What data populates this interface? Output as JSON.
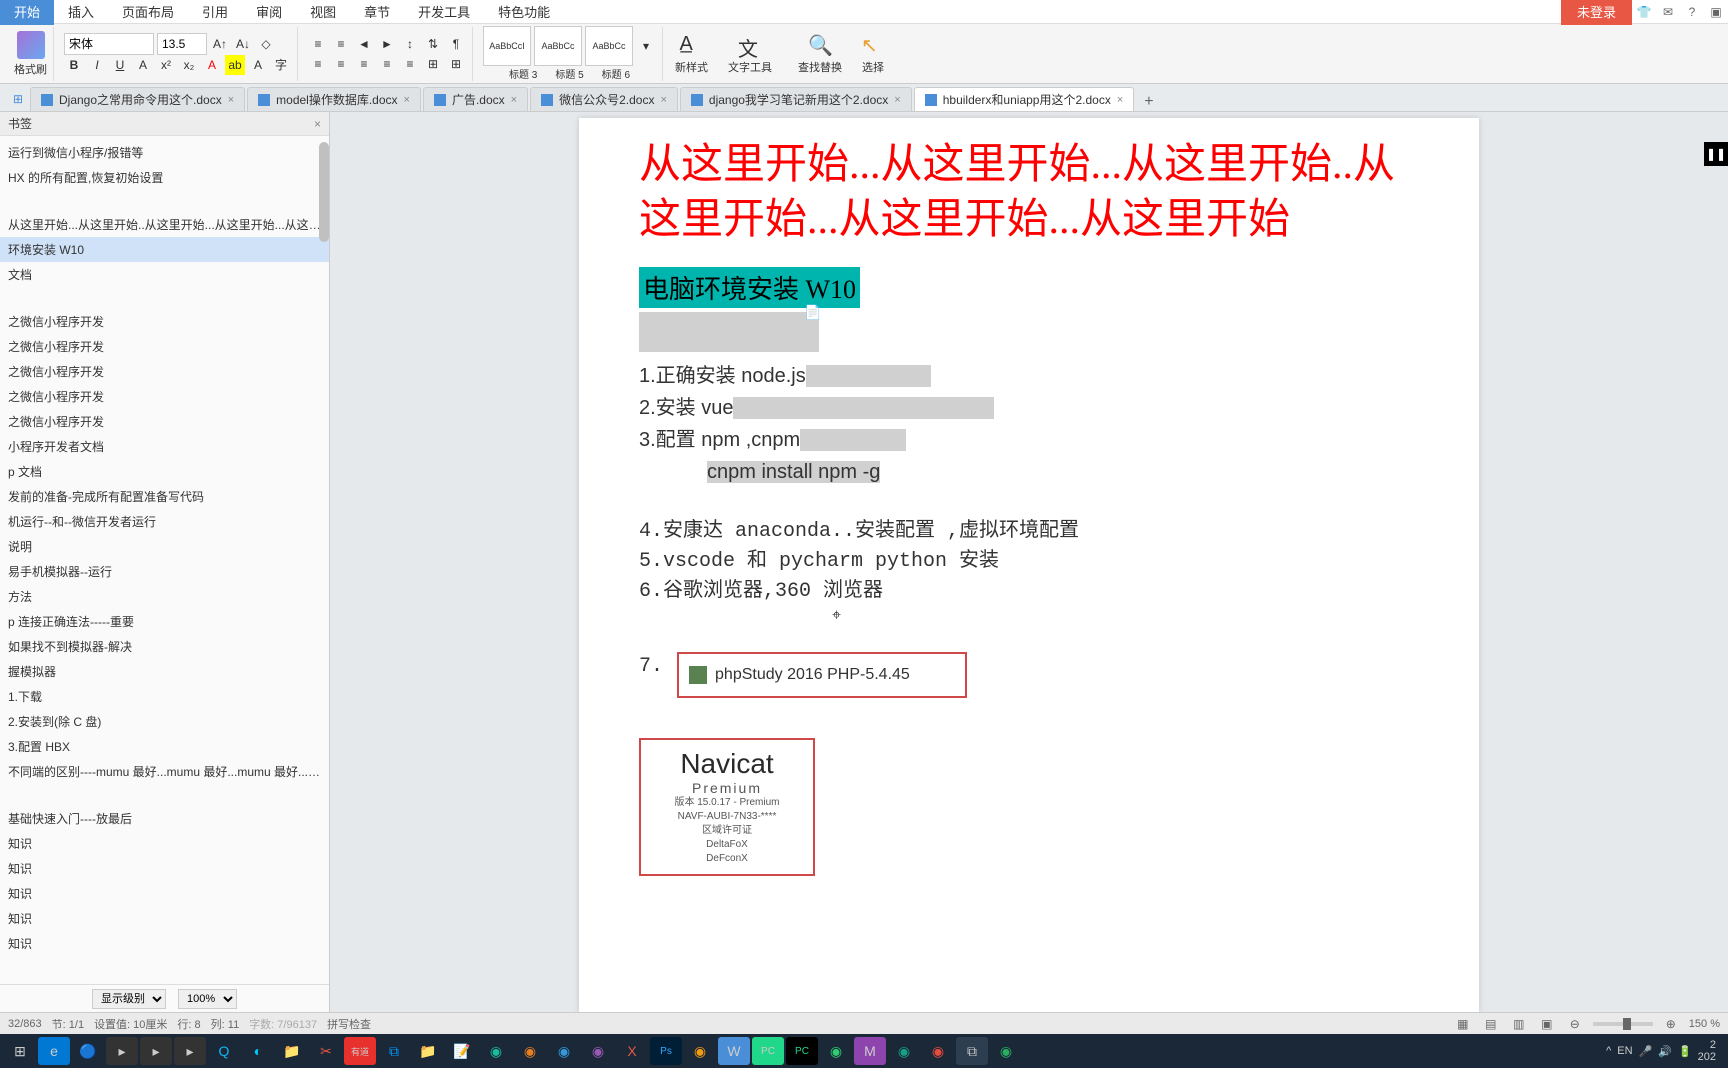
{
  "menu": {
    "items": [
      "开始",
      "插入",
      "页面布局",
      "引用",
      "审阅",
      "视图",
      "章节",
      "开发工具",
      "特色功能"
    ],
    "login": "未登录"
  },
  "toolbar": {
    "brush": "格式刷",
    "font": "宋体",
    "size": "13.5",
    "styles": [
      {
        "preview": "AaBbCcI",
        "label": "标题 3"
      },
      {
        "preview": "AaBbCc",
        "label": "标题 5"
      },
      {
        "preview": "AaBbCc",
        "label": "标题 6"
      }
    ],
    "newstyle": "新样式",
    "texttool": "文字工具",
    "findreplace": "查找替换",
    "select": "选择"
  },
  "tabs": [
    {
      "label": "Django之常用命令用这个.docx",
      "active": false
    },
    {
      "label": "model操作数据库.docx",
      "active": false
    },
    {
      "label": "广告.docx",
      "active": false
    },
    {
      "label": "微信公众号2.docx",
      "active": false
    },
    {
      "label": "django我学习笔记新用这个2.docx",
      "active": false
    },
    {
      "label": "hbuilderx和uniapp用这个2.docx",
      "active": true
    }
  ],
  "sidebar": {
    "title": "书签",
    "items": [
      "运行到微信小程序/报错等",
      "HX 的所有配置,恢复初始设置",
      "",
      "从这里开始...从这里开始..从这里开始...从这里开始...从这里开",
      "环境安装 W10",
      "文档",
      "",
      "之微信小程序开发",
      "之微信小程序开发",
      "之微信小程序开发",
      "之微信小程序开发",
      "之微信小程序开发",
      "小程序开发者文档",
      "p 文档",
      "发前的准备-完成所有配置准备写代码",
      "机运行--和--微信开发者运行",
      "说明",
      "易手机模拟器--运行",
      "方法",
      "p 连接正确连法-----重要",
      "如果找不到模拟器-解决",
      "握模拟器",
      "1.下载",
      "2.安装到(除 C 盘)",
      "3.配置 HBX",
      "不同端的区别----mumu 最好...mumu 最好...mumu 最好...mumu 最好",
      "",
      "基础快速入门----放最后",
      "知识",
      "知识",
      "知识",
      "知识",
      "知识"
    ],
    "selectedIndex": 4,
    "displayLevel": "显示级别",
    "zoom": "100%"
  },
  "document": {
    "redHeading": "从这里开始...从这里开始...从这里开始..从这里开始...从这里开始...从这里开始",
    "tealHeading": "电脑环境安装 W10",
    "steps": [
      "1.正确安装 node.js",
      "2.安装 vue",
      "3.配置 npm ,cnpm",
      "   cnpm install npm -g"
    ],
    "steps2": [
      "4.安康达 anaconda..安装配置 ,虚拟环境配置",
      "5.vscode 和  pycharm   python    安装",
      "6.谷歌浏览器,360 浏览器"
    ],
    "seven": "7.",
    "phpstudy": "phpStudy 2016   PHP-5.4.45",
    "navicat": {
      "title": "Navicat",
      "sub": "Premium",
      "v": "版本 15.0.17 - Premium",
      "key": "NAVF-AUBI-7N33-****",
      "lic": "区域许可证",
      "d1": "DeltaFoX",
      "d2": "DeFconX"
    }
  },
  "status": {
    "page": "32/863",
    "sect": "节: 1/1",
    "pos": "设置值: 10厘米",
    "row": "行: 8",
    "col": "列: 11",
    "words": "字数: 7/96137",
    "spell": "拼写检查",
    "zoom": "150 %"
  },
  "tray": {
    "ime": "EN",
    "time": "2",
    "date": "202"
  }
}
